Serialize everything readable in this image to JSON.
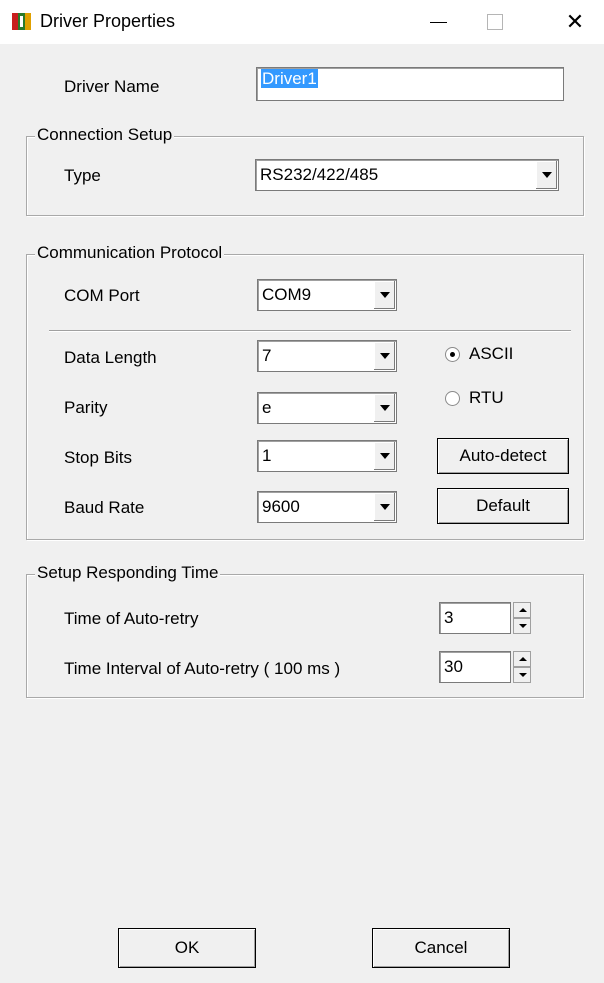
{
  "window": {
    "title": "Driver Properties",
    "close_glyph": "✕"
  },
  "driver_name": {
    "label": "Driver Name",
    "value": "Driver1"
  },
  "connection_setup": {
    "title": "Connection Setup",
    "type_label": "Type",
    "type_value": "RS232/422/485"
  },
  "communication_protocol": {
    "title": "Communication Protocol",
    "com_port_label": "COM Port",
    "com_port_value": "COM9",
    "data_length_label": "Data Length",
    "data_length_value": "7",
    "parity_label": "Parity",
    "parity_value": "e",
    "stop_bits_label": "Stop Bits",
    "stop_bits_value": "1",
    "baud_rate_label": "Baud Rate",
    "baud_rate_value": "9600",
    "mode_ascii_label": "ASCII",
    "mode_rtu_label": "RTU",
    "selected_mode": "ASCII",
    "auto_detect_label": "Auto-detect",
    "default_label": "Default"
  },
  "responding_time": {
    "title": "Setup Responding Time",
    "retry_label": "Time of Auto-retry",
    "retry_value": "3",
    "interval_label": "Time Interval of Auto-retry ( 100 ms )",
    "interval_value": "30"
  },
  "buttons": {
    "ok": "OK",
    "cancel": "Cancel"
  },
  "colors": {
    "selection": "#3399ff",
    "dialog_bg": "#f0f0f0"
  }
}
